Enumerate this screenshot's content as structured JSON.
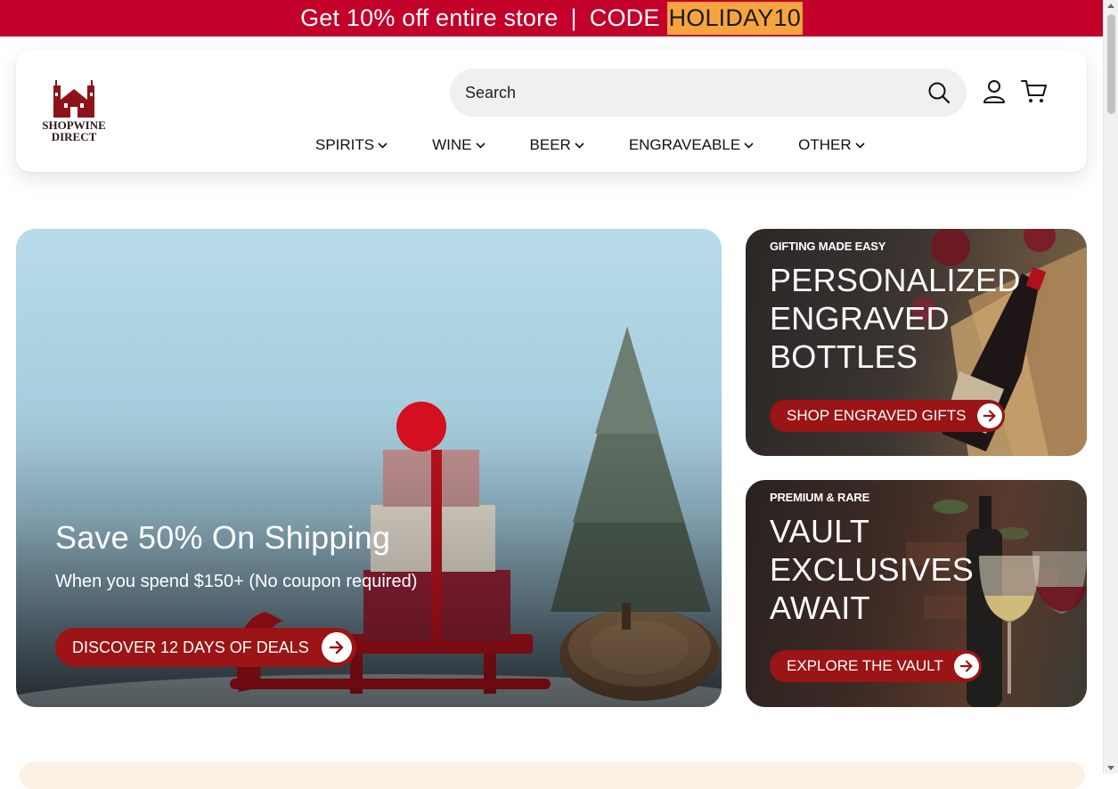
{
  "promo": {
    "text": "Get 10% off entire store",
    "separator": "|",
    "code_label": "CODE",
    "code": "HOLIDAY10",
    "bar_color": "#c20029",
    "code_highlight_color": "#f7a440"
  },
  "header": {
    "logo": {
      "line1": "SHOPWINE",
      "line2": "DIRECT",
      "icon": "winery-building-icon"
    },
    "search": {
      "placeholder": "Search",
      "value": "",
      "icon": "search-icon"
    },
    "icons": {
      "account": "user-icon",
      "cart": "cart-icon"
    },
    "nav": [
      {
        "label": "SPIRITS"
      },
      {
        "label": "WINE"
      },
      {
        "label": "BEER"
      },
      {
        "label": "ENGRAVEABLE"
      },
      {
        "label": "OTHER"
      }
    ]
  },
  "hero": {
    "title": "Save 50% On Shipping",
    "subtitle": "When you spend $150+ (No coupon required)",
    "cta_label": "DISCOVER 12 DAYS OF DEALS"
  },
  "cards": [
    {
      "eyebrow": "GIFTING MADE EASY",
      "headline": [
        "PERSONALIZED",
        "ENGRAVED",
        "BOTTLES"
      ],
      "cta_label": "SHOP ENGRAVED GIFTS"
    },
    {
      "eyebrow": "PREMIUM & RARE",
      "headline": [
        "VAULT",
        "EXCLUSIVES",
        "AWAIT"
      ],
      "cta_label": "EXPLORE THE VAULT"
    }
  ],
  "colors": {
    "accent": "#9b1416",
    "brand_red": "#c20029"
  }
}
